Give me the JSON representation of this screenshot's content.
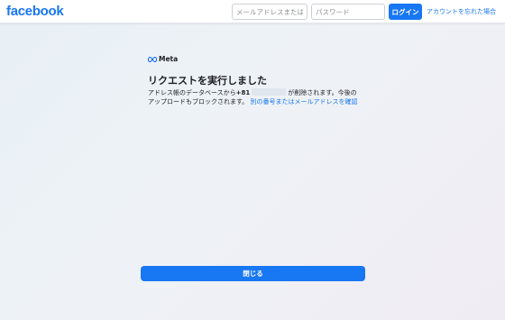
{
  "header": {
    "logo": "facebook",
    "email_placeholder": "メールアドレスまたは電",
    "password_placeholder": "パスワード",
    "login_label": "ログイン",
    "forgot_label": "アカウントを忘れた場合"
  },
  "main": {
    "brand": "Meta",
    "title": "リクエストを実行しました",
    "message_before": "アドレス帳のデータベースから",
    "phone_prefix": "+81",
    "message_after": "が削除されます。今後のアップロードもブロックされます。",
    "confirm_link": "別の番号またはメールアドレスを確認",
    "close_label": "閉じる"
  },
  "colors": {
    "brand_blue": "#1877f2",
    "background": "#eef2f6"
  }
}
